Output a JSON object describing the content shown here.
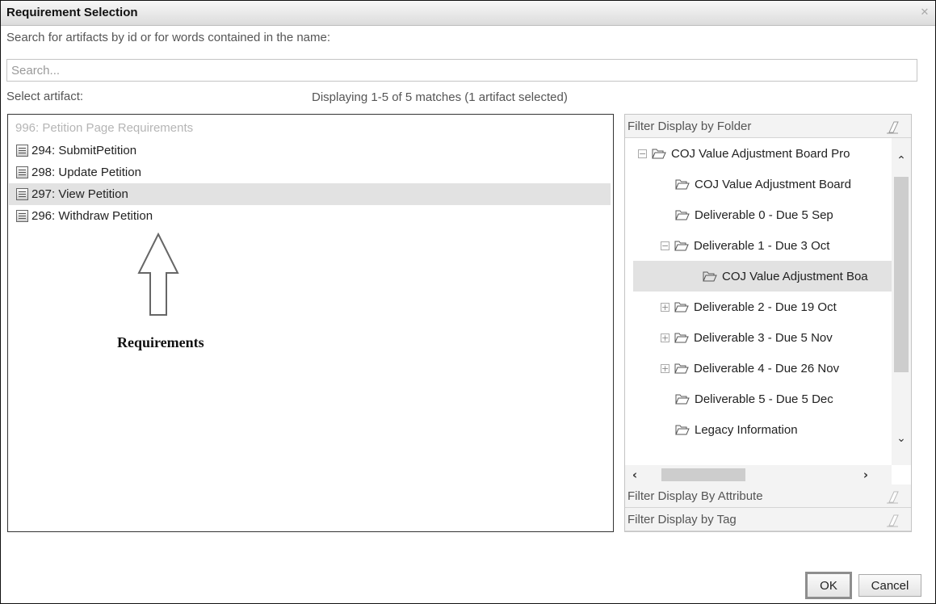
{
  "dialog": {
    "title": "Requirement Selection",
    "close_icon": "close-icon"
  },
  "search": {
    "prompt": "Search for artifacts by id or for words contained in the name:",
    "placeholder": "Search...",
    "value": ""
  },
  "selection": {
    "label": "Select artifact:",
    "status": "Displaying 1-5 of 5 matches (1 artifact selected)"
  },
  "artifacts": {
    "header": "996: Petition Page Requirements",
    "items": [
      {
        "label": "294: SubmitPetition",
        "selected": false
      },
      {
        "label": "298: Update Petition",
        "selected": false
      },
      {
        "label": "297: View Petition",
        "selected": true
      },
      {
        "label": "296: Withdraw Petition",
        "selected": false
      }
    ]
  },
  "annotation": {
    "label": "Requirements"
  },
  "filters": {
    "folder_header": "Filter Display by Folder",
    "attribute_header": "Filter Display By Attribute",
    "tag_header": "Filter Display by Tag",
    "tree": [
      {
        "label": "COJ Value Adjustment Board Pro",
        "toggle": "−",
        "highlighted": false
      },
      {
        "label": "COJ Value Adjustment Board",
        "toggle": "",
        "highlighted": false
      },
      {
        "label": "Deliverable 0 - Due 5 Sep",
        "toggle": "",
        "highlighted": false
      },
      {
        "label": "Deliverable 1 - Due 3 Oct",
        "toggle": "−",
        "highlighted": false
      },
      {
        "label": "COJ Value Adjustment Boa",
        "toggle": "",
        "highlighted": true
      },
      {
        "label": "Deliverable 2 - Due 19 Oct",
        "toggle": "+",
        "highlighted": false
      },
      {
        "label": "Deliverable 3 - Due 5 Nov",
        "toggle": "+",
        "highlighted": false
      },
      {
        "label": "Deliverable 4 - Due 26 Nov",
        "toggle": "+",
        "highlighted": false
      },
      {
        "label": "Deliverable 5 - Due 5 Dec",
        "toggle": "",
        "highlighted": false
      },
      {
        "label": "Legacy Information",
        "toggle": "",
        "highlighted": false
      }
    ]
  },
  "buttons": {
    "ok": "OK",
    "cancel": "Cancel"
  },
  "icons": {
    "item": "requirement-icon",
    "folder": "folder-open-icon",
    "eraser": "eraser-icon",
    "arrow": "up-arrow-icon"
  },
  "colors": {
    "selected_row": "#e2e2e2",
    "header_bg": "#f3f3f3",
    "border": "#333333"
  }
}
